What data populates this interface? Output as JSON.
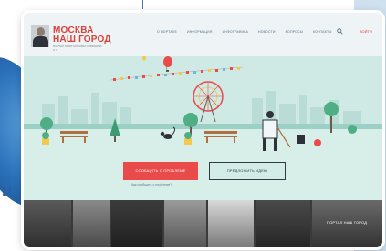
{
  "header": {
    "logo_line1": "МОСКВА",
    "logo_line2": "НАШ ГОРОД",
    "logo_subtitle": "ПОРТАЛ МЭРА МОСКВЫ СОБЯНИНА С.С.",
    "nav": [
      "О ПОРТАЛЕ",
      "ИНФОРМАЦИЯ",
      "ИНФОГРАФИКА",
      "НОВОСТИ",
      "ВОПРОСЫ",
      "КОНТАКТЫ"
    ],
    "login": "ВОЙТИ"
  },
  "hero": {
    "primary_button": "СООБЩИТЬ О ПРОБЛЕМЕ",
    "secondary_button": "ПРЕДЛОЖИТЬ ИДЕЮ",
    "help_link": "Как сообщить о проблеме?"
  },
  "gallery": {
    "label": "ПОРТАЛ НАШ ГОРОД"
  },
  "colors": {
    "brand_red": "#d9423a",
    "button_red": "#e94a4a",
    "scene_mint": "#cfe9e4",
    "nav_blue": "#4b6d86"
  }
}
